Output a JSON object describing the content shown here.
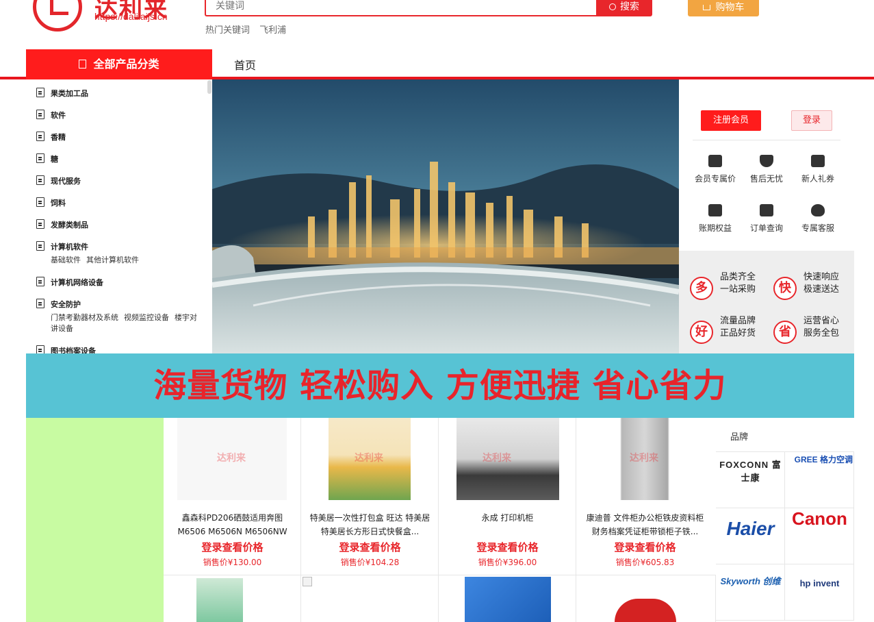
{
  "header": {
    "logo_cn": "达利来",
    "logo_url": "https://dalilaijs.cn",
    "search_placeholder": "关键词",
    "search_button": "搜索",
    "hot_label": "热门关键词",
    "hot_keyword": "飞利浦",
    "cart_label": "购物车"
  },
  "nav": {
    "all_categories": "全部产品分类",
    "home": "首页"
  },
  "categories": [
    {
      "name": "果类加工品"
    },
    {
      "name": "软件"
    },
    {
      "name": "香精"
    },
    {
      "name": "糖"
    },
    {
      "name": "现代服务"
    },
    {
      "name": "饲料"
    },
    {
      "name": "发酵类制品"
    },
    {
      "name": "计算机软件",
      "subs": [
        "基础软件",
        "其他计算机软件"
      ]
    },
    {
      "name": "计算机网络设备"
    },
    {
      "name": "安全防护",
      "subs": [
        "门禁考勤器材及系统",
        "视频监控设备",
        "楼宇对讲设备"
      ]
    },
    {
      "name": "图书档案设备"
    }
  ],
  "member": {
    "register": "注册会员",
    "login": "登录",
    "items": [
      {
        "label": "会员专属价",
        "icon": "tag-icon"
      },
      {
        "label": "售后无忧",
        "icon": "shield-icon"
      },
      {
        "label": "新人礼券",
        "icon": "coupon-icon"
      },
      {
        "label": "账期权益",
        "icon": "crown-icon"
      },
      {
        "label": "订单查询",
        "icon": "document-icon"
      },
      {
        "label": "专属客服",
        "icon": "headset-icon"
      }
    ]
  },
  "promo": [
    {
      "badge": "多",
      "line1": "品类齐全",
      "line2": "一站采购"
    },
    {
      "badge": "快",
      "line1": "快速响应",
      "line2": "极速送达"
    },
    {
      "badge": "好",
      "line1": "流量品牌",
      "line2": "正品好货"
    },
    {
      "badge": "省",
      "line1": "运营省心",
      "line2": "服务全包"
    }
  ],
  "slogan": "海量货物 轻松购入 方便迅捷 省心省力",
  "products": [
    {
      "name": "鑫森科PD206硒鼓适用奔图M6506 M6506N M6506NW M6...",
      "login_price": "登录查看价格",
      "price": "销售价¥130.00",
      "watermark": "达利来"
    },
    {
      "name": "特美居一次性打包盒 旺达 特美居 特美居长方形日式快餐盒...",
      "login_price": "登录查看价格",
      "price": "销售价¥104.28",
      "watermark": "达利来"
    },
    {
      "name": "永成 打印机柜",
      "login_price": "登录查看价格",
      "price": "销售价¥396.00",
      "watermark": "达利来"
    },
    {
      "name": "康迪普 文件柜办公柜铁皮资料柜财务档案凭证柜带锁柜子铁...",
      "login_price": "登录查看价格",
      "price": "销售价¥605.83",
      "watermark": "达利来"
    }
  ],
  "brands": {
    "title": "品牌",
    "items": [
      "FOXCONN 富士康",
      "GREE 格力空调",
      "Haier",
      "Canon",
      "Skyworth 创维",
      "hp invent"
    ]
  },
  "colors": {
    "brand_red": "#e8262b",
    "slogan_bg": "#57c3d4",
    "cart_orange": "#f2a541",
    "side_green": "#c8fba2"
  }
}
